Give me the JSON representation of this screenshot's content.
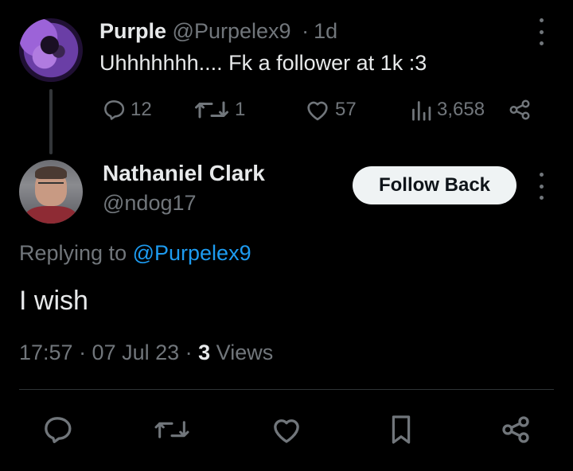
{
  "original_tweet": {
    "display_name": "Purple",
    "handle": "@Purpelex9",
    "separator": "·",
    "time": "1d",
    "text": "Uhhhhhhh.... Fk a follower at 1k :3",
    "actions": {
      "replies": "12",
      "reposts": "1",
      "likes": "57",
      "views": "3,658"
    }
  },
  "reply_tweet": {
    "display_name": "Nathaniel Clark",
    "handle": "@ndog17",
    "follow_button": "Follow Back",
    "replying_prefix": "Replying to ",
    "replying_to": "@Purpelex9",
    "text": "I wish",
    "timestamp": "17:57 · 07 Jul 23 · ",
    "views_count": "3",
    "views_label": " Views"
  },
  "icons": {
    "reply": "reply-icon",
    "repost": "repost-icon",
    "like": "like-icon",
    "views": "views-icon",
    "share": "share-icon",
    "bookmark": "bookmark-icon",
    "more": "more-icon"
  },
  "colors": {
    "background": "#000000",
    "text": "#e7e9ea",
    "muted": "#71767b",
    "link": "#1d9bf0",
    "button_bg": "#eff3f4"
  }
}
